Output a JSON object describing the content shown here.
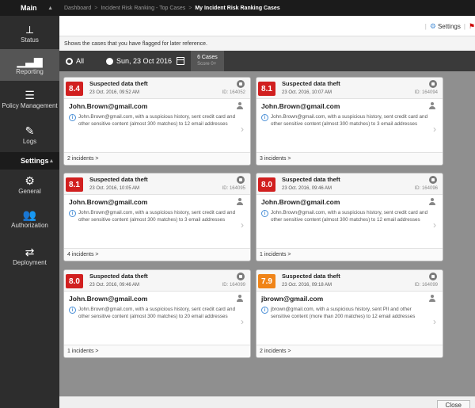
{
  "sidebar": {
    "main_label": "Main",
    "settings_label": "Settings",
    "items": [
      {
        "label": "Status",
        "icon": "pulse-icon"
      },
      {
        "label": "Reporting",
        "icon": "bar-chart-icon"
      },
      {
        "label": "Policy Management",
        "icon": "policy-list-icon"
      },
      {
        "label": "Logs",
        "icon": "logs-icon"
      }
    ],
    "settings_items": [
      {
        "label": "General",
        "icon": "gear-icon"
      },
      {
        "label": "Authorization",
        "icon": "users-icon"
      },
      {
        "label": "Deployment",
        "icon": "deployment-icon"
      }
    ]
  },
  "breadcrumb": {
    "items": [
      "Dashboard",
      "Incident Risk Ranking - Top Cases"
    ],
    "current": "My Incident Risk Ranking Cases",
    "separator": ">"
  },
  "toolbar": {
    "settings_label": "Settings"
  },
  "description": "Shows the cases that you have flagged for later reference.",
  "filter": {
    "all_label": "All",
    "date_label": "Sun, 23 Oct 2016",
    "count_label": "6 Cases",
    "count_sub": "Score 0+"
  },
  "cards": [
    {
      "score": "8.4",
      "score_color": "red",
      "type": "Suspected data theft",
      "time": "23 Oct. 2016, 09:52 AM",
      "id": "ID: 164052",
      "user": "John.Brown@gmail.com",
      "description": "John.Brown@gmail.com, with a suspicious history, sent credit card and other sensitive content (almost 300 matches) to 12 email addresses",
      "incidents": "2 incidents >"
    },
    {
      "score": "8.1",
      "score_color": "red",
      "type": "Suspected data theft",
      "time": "23 Oct. 2016, 10:07 AM",
      "id": "ID: 164094",
      "user": "John.Brown@gmail.com",
      "description": "John.Brown@gmail.com, with a suspicious history, sent credit card and other sensitive content (almost 300 matches) to 3 email addresses",
      "incidents": "3 incidents >"
    },
    {
      "score": "8.1",
      "score_color": "red",
      "type": "Suspected data theft",
      "time": "23 Oct. 2016, 10:05 AM",
      "id": "ID: 164095",
      "user": "John.Brown@gmail.com",
      "description": "John.Brown@gmail.com, with a suspicious history, sent credit card and other sensitive content (almost 300 matches) to 3 email addresses",
      "incidents": "4 incidents >"
    },
    {
      "score": "8.0",
      "score_color": "red",
      "type": "Suspected data theft",
      "time": "23 Oct. 2016, 09:46 AM",
      "id": "ID: 164096",
      "user": "John.Brown@gmail.com",
      "description": "John.Brown@gmail.com, with a suspicious history, sent credit card and other sensitive content (almost 300 matches) to 12 email addresses",
      "incidents": "1 incidents >"
    },
    {
      "score": "8.0",
      "score_color": "red",
      "type": "Suspected data theft",
      "time": "23 Oct. 2016, 09:46 AM",
      "id": "ID: 164099",
      "user": "John.Brown@gmail.com",
      "description": "John.Brown@gmail.com, with a suspicious history, sent credit card and other sensitive content (almost 300 matches) to 20 email addresses",
      "incidents": "1 incidents >"
    },
    {
      "score": "7.9",
      "score_color": "orange",
      "type": "Suspected data theft",
      "time": "23 Oct. 2016, 09:18 AM",
      "id": "ID: 164099",
      "user": "jbrown@gmail.com",
      "description": "jbrown@gmail.com, with a suspicious history, sent PII and other sensitive content (more than 200 matches) to 12 email addresses",
      "incidents": "2 incidents >"
    }
  ],
  "footer": {
    "close_label": "Close"
  }
}
